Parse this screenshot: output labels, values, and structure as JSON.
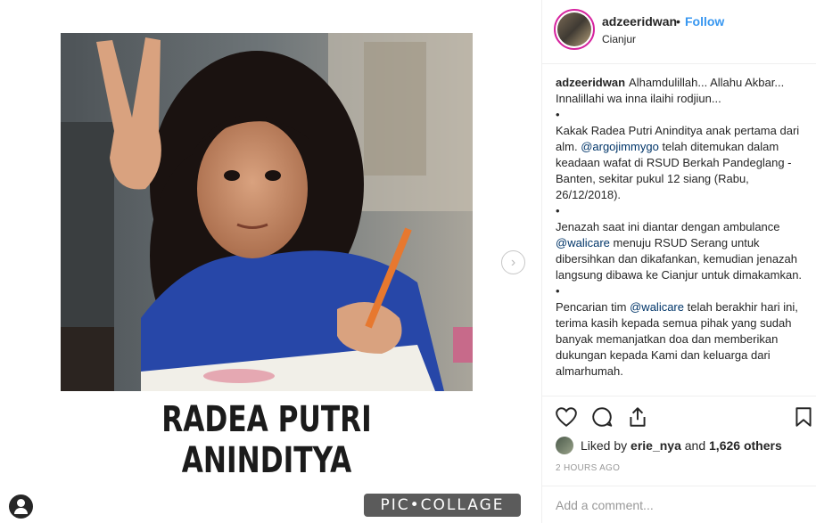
{
  "media": {
    "big_caption": "RADEA PUTRI ANINDITYA",
    "watermark": "PIC•COLLAGE",
    "next_icon": "chevron-right-icon",
    "tagged_icon": "user-tag-icon"
  },
  "header": {
    "username": "adzeeridwan",
    "separator": "•",
    "follow_label": "Follow",
    "location": "Cianjur"
  },
  "caption": {
    "username": "adzeeridwan",
    "lines": [
      "Alhamdulillah... Allahu Akbar...",
      "Innalillahi wa inna ilaihi rodjiun...",
      "•",
      "Kakak Radea Putri Aninditya anak pertama dari alm.",
      "@argojimmygo",
      "telah ditemukan dalam keadaan wafat di RSUD Berkah Pandeglang - Banten, sekitar pukul 12 siang (Rabu, 26/12/2018).",
      "•",
      "Jenazah saat ini diantar dengan ambulance",
      "@walicare",
      "menuju RSUD Serang untuk dibersihkan dan dikafankan, kemudian jenazah langsung dibawa ke Cianjur untuk dimakamkan.",
      "•",
      "Pencarian tim",
      "@walicare",
      "telah berakhir hari ini, terima kasih kepada semua pihak yang sudah banyak memanjatkan doa dan memberikan dukungan kepada Kami dan keluarga dari almarhumah."
    ]
  },
  "actions": {
    "like_icon": "heart-icon",
    "comment_icon": "comment-bubble-icon",
    "share_icon": "share-icon",
    "save_icon": "bookmark-icon"
  },
  "likes": {
    "prefix": "Liked by",
    "user": "erie_nya",
    "middle": "and",
    "count": "1,626 others"
  },
  "timestamp": "2 HOURS AGO",
  "comment": {
    "placeholder": "Add a comment..."
  },
  "colors": {
    "accent_link": "#3897f0",
    "mention": "#003569",
    "muted": "#999999"
  }
}
